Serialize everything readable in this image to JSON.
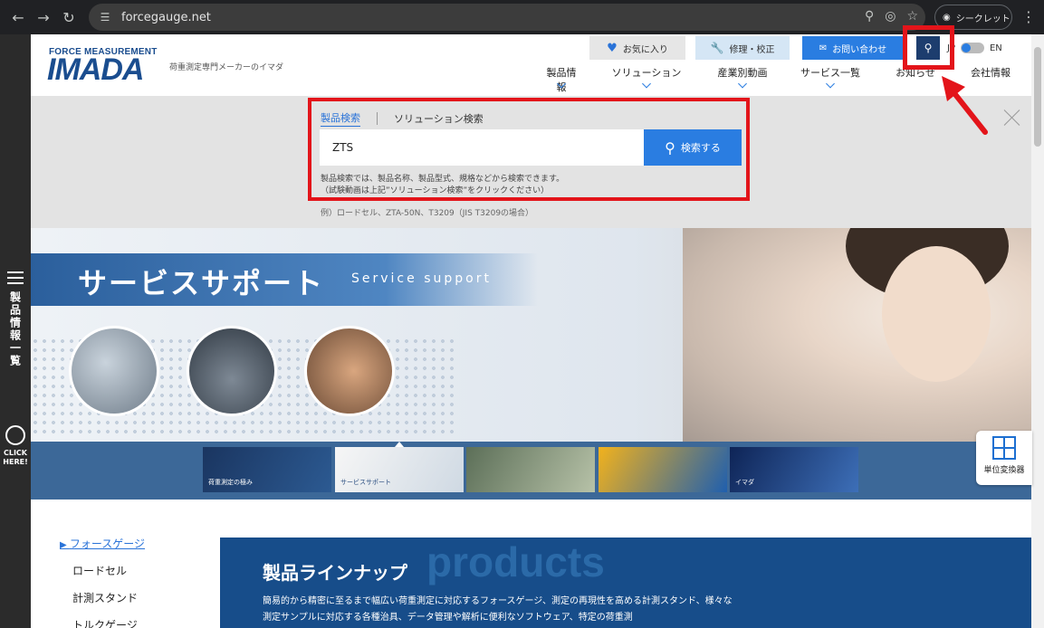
{
  "browser": {
    "url": "forcegauge.net",
    "incognito_label": "シークレット"
  },
  "leftrail": {
    "menu_label": "製品情報一覧",
    "click_here": "CLICK HERE!"
  },
  "header": {
    "logo_small": "FORCE MEASUREMENT",
    "logo_big": "IMADA",
    "tagline": "荷重測定専門メーカーのイマダ",
    "util": {
      "favorites": "お気に入り",
      "repair": "修理・校正",
      "contact": "お問い合わせ"
    },
    "lang": {
      "jp": "JP",
      "en": "EN"
    },
    "nav": [
      "製品情報",
      "ソリューション",
      "産業別動画",
      "サービス一覧",
      "お知らせ",
      "会社情報"
    ]
  },
  "search": {
    "tab_product": "製品検索",
    "tab_solution": "ソリューション検索",
    "input_value": "ZTS",
    "button_label": "検索する",
    "help_line1": "製品検索では、製品名称、製品型式、規格などから検索できます。",
    "help_line2": "（試験動画は上記”ソリューション検索”をクリックください）",
    "example": "例）ロードセル、ZTA-50N、T3209（JIS T3209の場合）"
  },
  "hero": {
    "title": "サービスサポート",
    "subtitle": "Service support",
    "thumbnails": [
      "荷重測定の極み",
      "サービスサポート",
      "",
      "",
      "イマダ"
    ]
  },
  "unit_converter": {
    "label": "単位変換器"
  },
  "sidebar": {
    "links": [
      "フォースゲージ",
      "ロードセル",
      "計測スタンド",
      "トルクゲージ"
    ]
  },
  "products": {
    "ghost": "products",
    "title": "製品ラインナップ",
    "text": "簡易的から精密に至るまで幅広い荷重測定に対応するフォースゲージ、測定の再現性を高める計測スタンド、様々な測定サンプルに対応する各種治具、データ管理や解析に便利なソフトウェア、特定の荷重測"
  },
  "colors": {
    "accent": "#2a7de1",
    "brand": "#1a4d8f",
    "annotation": "#e3141a"
  }
}
